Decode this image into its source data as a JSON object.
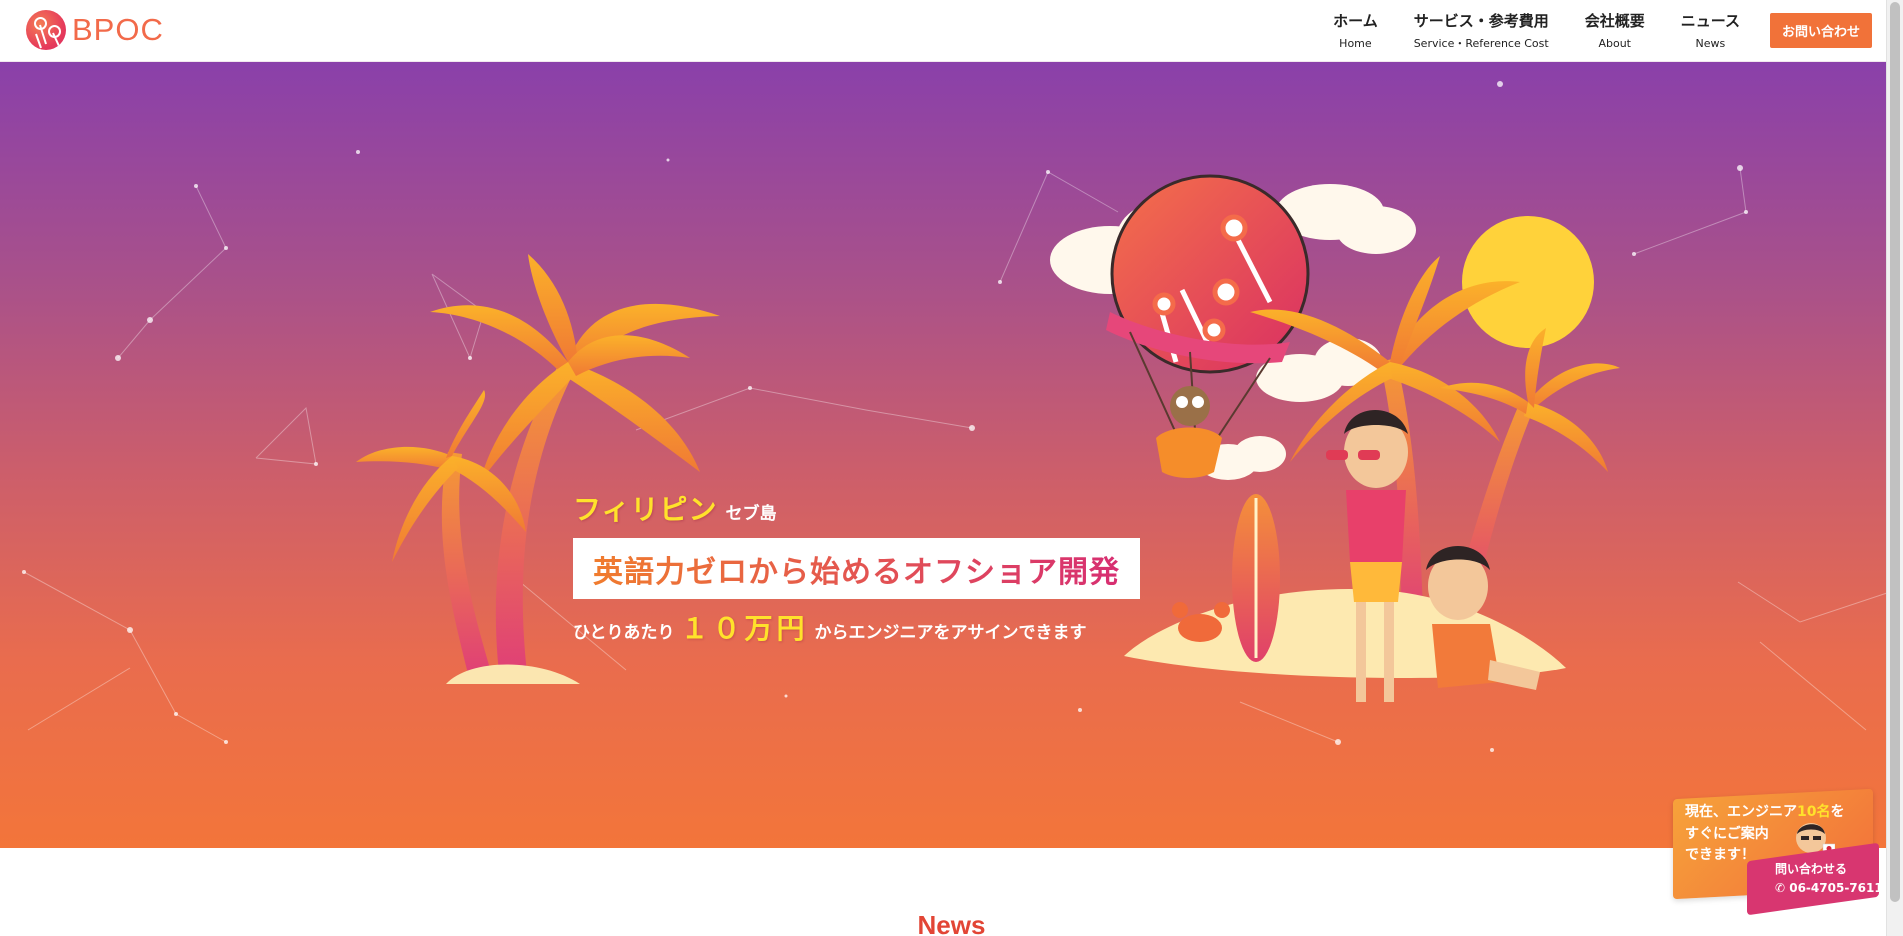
{
  "header": {
    "logo_text": "BPOC",
    "nav": [
      {
        "jp": "ホーム",
        "en": "Home",
        "active": true
      },
      {
        "jp": "サービス・参考費用",
        "en": "Service・Reference Cost",
        "active": false
      },
      {
        "jp": "会社概要",
        "en": "About",
        "active": false
      },
      {
        "jp": "ニュース",
        "en": "News",
        "active": false
      }
    ],
    "contact_label": "お問い合わせ"
  },
  "hero": {
    "line1_big": "フィリピン",
    "line1_small": "セブ島",
    "headline": "英語力ゼロから始めるオフショア開発",
    "line3_a": "ひとりあたり",
    "line3_price": "１０万円",
    "line3_c": "からエンジニアをアサインできます"
  },
  "widget": {
    "line1_a": "現在、エンジニア",
    "line1_hl": "10名",
    "line1_b": "を",
    "line2": "すぐにご案内",
    "line3": "できます！",
    "call_label": "問い合わせる",
    "phone": "06-4705-7611"
  },
  "news": {
    "title": "News"
  },
  "colors": {
    "accent": "#f17239",
    "news_title": "#e24535",
    "highlight_yellow": "#ffe22b"
  }
}
